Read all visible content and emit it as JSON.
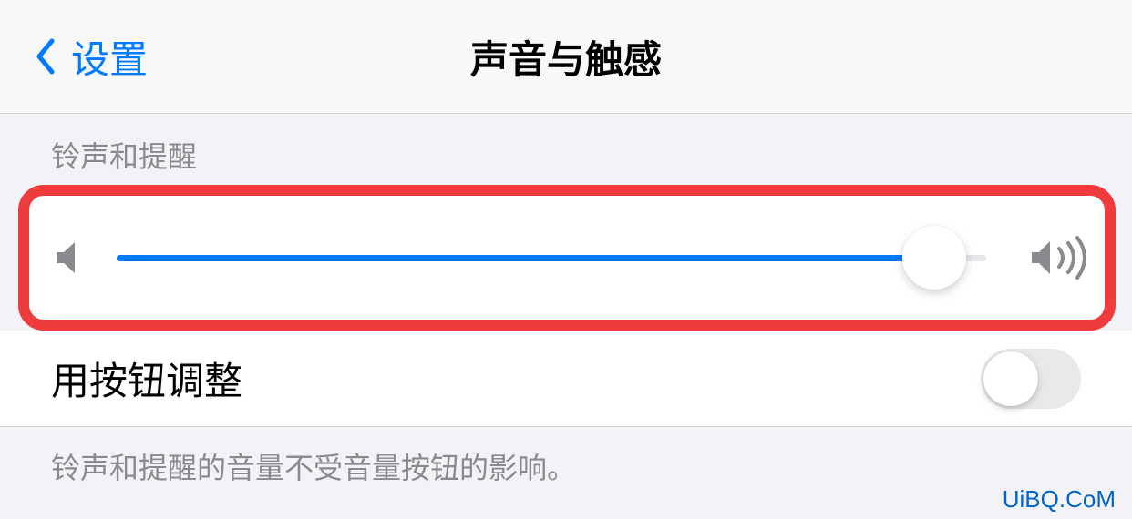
{
  "header": {
    "back_label": "设置",
    "title": "声音与触感"
  },
  "section": {
    "header": "铃声和提醒",
    "slider_value_percent": 94
  },
  "toggle_row": {
    "label": "用按钮调整",
    "enabled": false
  },
  "footer": "铃声和提醒的音量不受音量按钮的影响。",
  "watermark": "UiBQ.CoM"
}
